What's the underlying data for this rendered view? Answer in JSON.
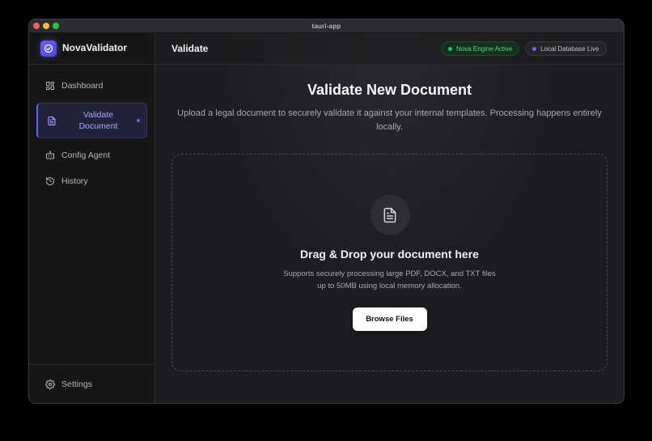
{
  "window": {
    "title": "tauri-app"
  },
  "sidebar": {
    "brand": "NovaValidator",
    "items": [
      {
        "label": "Dashboard",
        "icon": "dashboard-icon"
      },
      {
        "label": "Validate Document",
        "label_line1": "Validate",
        "label_line2": "Document",
        "icon": "document-icon",
        "active": true
      },
      {
        "label": "Config Agent",
        "icon": "robot-icon"
      },
      {
        "label": "History",
        "icon": "history-icon"
      }
    ],
    "footer": {
      "label": "Settings",
      "icon": "gear-icon"
    }
  },
  "topbar": {
    "title": "Validate",
    "status_engine": "Nova Engine Active",
    "status_db": "Local Database Live"
  },
  "main": {
    "heading": "Validate New Document",
    "subheading_line1": "Upload a legal document to securely validate it against your internal templates. Processing happens entirely",
    "subheading_line2": "locally.",
    "dropzone": {
      "title": "Drag & Drop your document here",
      "desc_line1": "Supports securely processing large PDF, DOCX, and TXT files",
      "desc_line2": "up to 50MB using local memory allocation.",
      "button": "Browse Files"
    }
  },
  "colors": {
    "accent": "#6366f1",
    "success": "#22c55e",
    "background": "#1c1c1e"
  }
}
